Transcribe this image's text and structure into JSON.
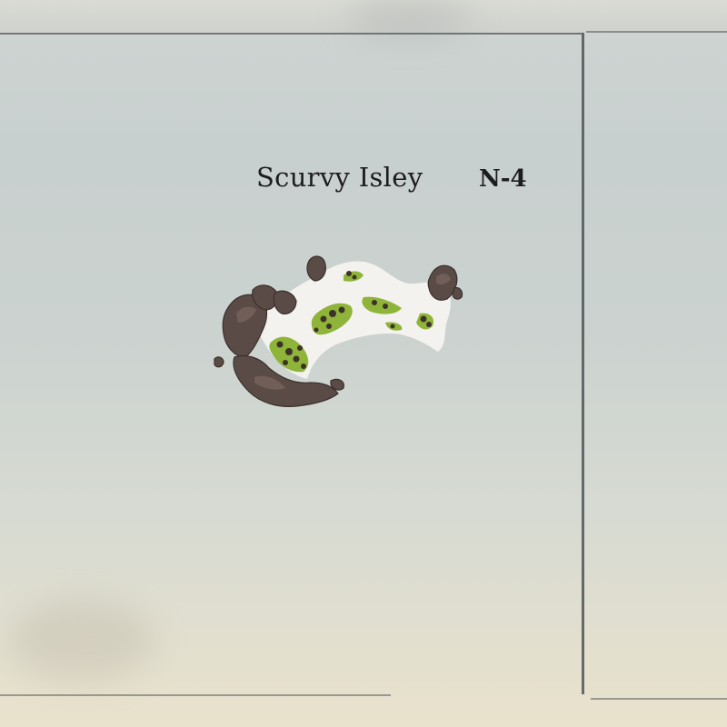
{
  "map": {
    "island_name": "Scurvy Isley",
    "grid_reference": "N-4",
    "island_icon": "island-illustration",
    "colors": {
      "parchment": "#cbd2cf",
      "ink": "#1d1d1d",
      "grid_line": "#4f5556",
      "sand": "#f4f2ee",
      "foliage": "#8fb43a",
      "rock": "#5b4b47"
    }
  }
}
